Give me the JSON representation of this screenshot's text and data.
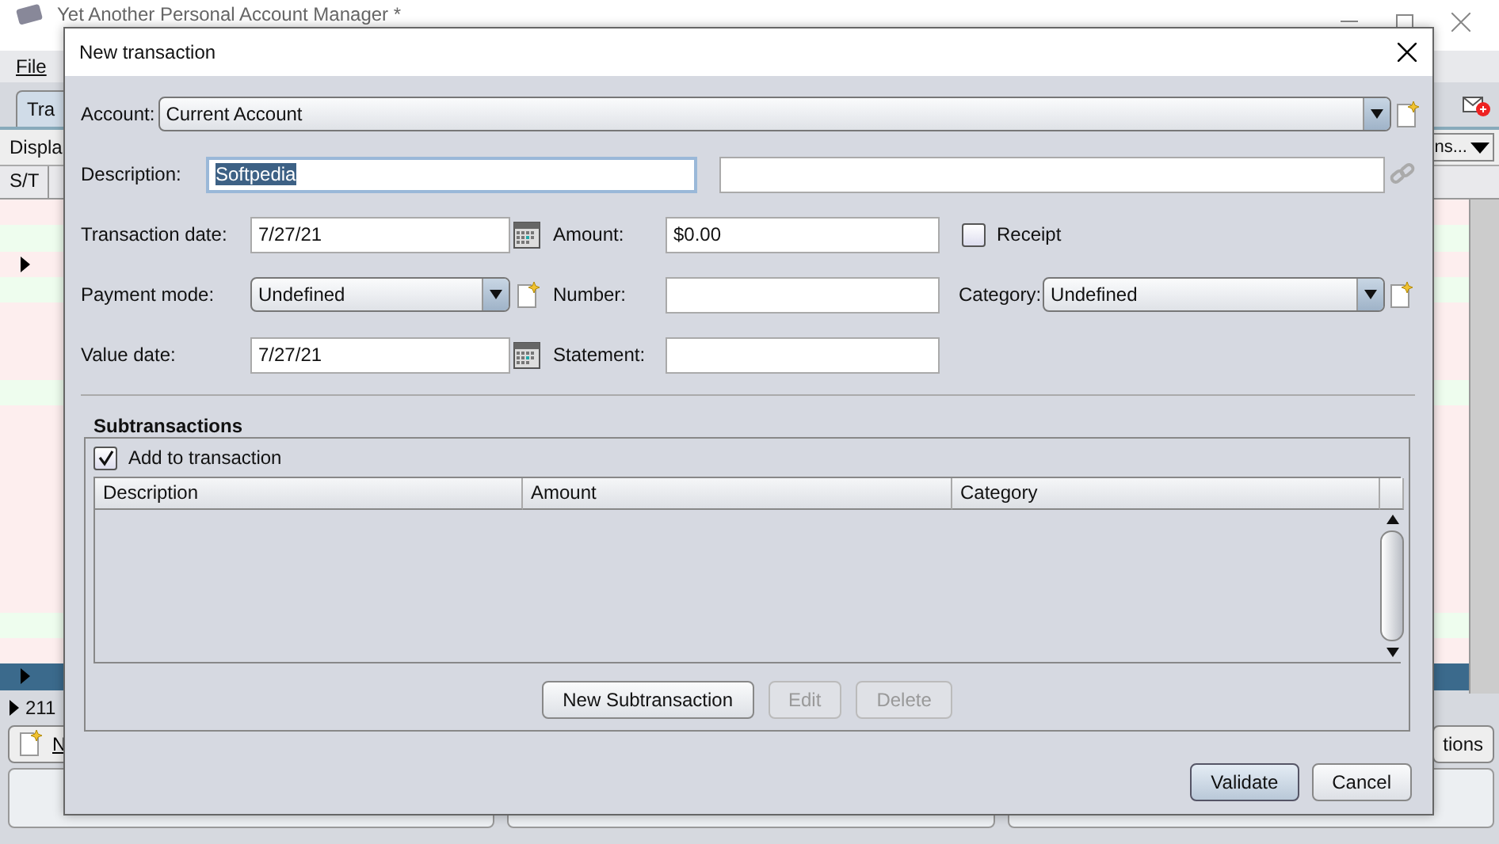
{
  "app": {
    "title": "Yet Another Personal Account Manager *",
    "menu": [
      "File"
    ],
    "tab": "Tra",
    "display_label": "Displa",
    "display_dropdown": "ns...",
    "columns": [
      "S/T"
    ],
    "rows": [
      {
        "color": "#fdeeee",
        "current": false,
        "selected": false
      },
      {
        "color": "#eefdee",
        "current": false,
        "selected": false
      },
      {
        "color": "#fdeeee",
        "current": true,
        "selected": false
      },
      {
        "color": "#eefdee",
        "current": false,
        "selected": false
      },
      {
        "color": "#fdeeee",
        "current": false,
        "selected": false
      },
      {
        "color": "#fdeeee",
        "current": false,
        "selected": false
      },
      {
        "color": "#fdeeee",
        "current": false,
        "selected": false
      },
      {
        "color": "#eefdee",
        "current": false,
        "selected": false
      },
      {
        "color": "#fdeeee",
        "current": false,
        "selected": false
      },
      {
        "color": "#fdeeee",
        "current": false,
        "selected": false
      },
      {
        "color": "#fdeeee",
        "current": false,
        "selected": false
      },
      {
        "color": "#fdeeee",
        "current": false,
        "selected": false
      },
      {
        "color": "#fdeeee",
        "current": false,
        "selected": false
      },
      {
        "color": "#fdeeee",
        "current": false,
        "selected": false
      },
      {
        "color": "#fdeeee",
        "current": false,
        "selected": false
      },
      {
        "color": "#fdeeee",
        "current": false,
        "selected": false
      },
      {
        "color": "#eefdee",
        "current": false,
        "selected": false
      },
      {
        "color": "#fdeeee",
        "current": false,
        "selected": false
      },
      {
        "current": true,
        "selected": true
      }
    ],
    "count": "211",
    "new_button": "N",
    "options_button": "tions"
  },
  "dialog": {
    "title": "New transaction",
    "account": {
      "label": "Account:",
      "value": "Current Account"
    },
    "description": {
      "label": "Description:",
      "value": "Softpedia",
      "value_selected": true
    },
    "transaction_date": {
      "label": "Transaction date:",
      "value": "7/27/21"
    },
    "amount": {
      "label": "Amount:",
      "value": "$0.00"
    },
    "receipt": {
      "label": "Receipt",
      "checked": false
    },
    "payment_mode": {
      "label": "Payment mode:",
      "value": "Undefined"
    },
    "number": {
      "label": "Number:"
    },
    "category": {
      "label": "Category:",
      "value": "Undefined"
    },
    "value_date": {
      "label": "Value date:",
      "value": "7/27/21"
    },
    "statement": {
      "label": "Statement:"
    },
    "subtransactions": {
      "title": "Subtransactions",
      "add_to_transaction": {
        "label": "Add to transaction",
        "checked": true
      },
      "columns": [
        "Description",
        "Amount",
        "Category"
      ],
      "buttons": [
        {
          "label": "New Subtransaction",
          "disabled": false
        },
        {
          "label": "Edit",
          "disabled": true
        },
        {
          "label": "Delete",
          "disabled": true
        }
      ]
    },
    "buttons": [
      {
        "label": "Validate",
        "default": true
      },
      {
        "label": "Cancel",
        "default": false
      }
    ]
  }
}
